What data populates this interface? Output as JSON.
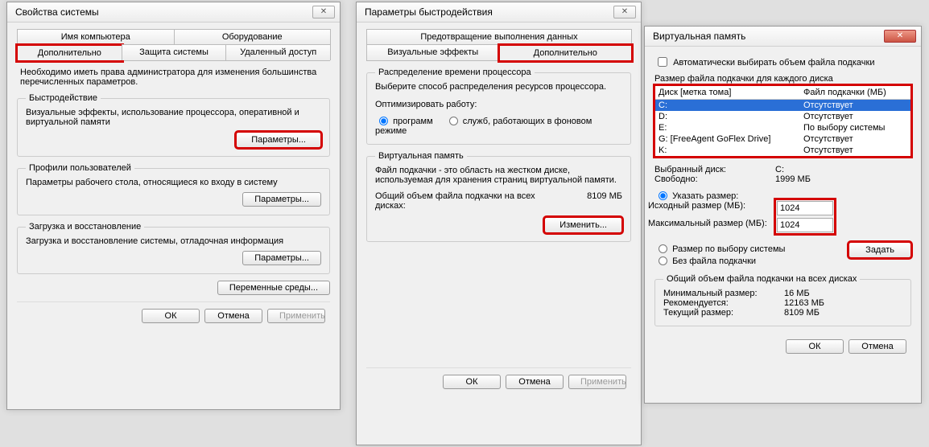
{
  "win1": {
    "title": "Свойства системы",
    "tabs_row1": [
      "Имя компьютера",
      "Оборудование"
    ],
    "tabs_row2": [
      "Дополнительно",
      "Защита системы",
      "Удаленный доступ"
    ],
    "note": "Необходимо иметь права администратора для изменения большинства перечисленных параметров.",
    "perf": {
      "legend": "Быстродействие",
      "text": "Визуальные эффекты, использование процессора, оперативной и виртуальной памяти",
      "btn": "Параметры..."
    },
    "profiles": {
      "legend": "Профили пользователей",
      "text": "Параметры рабочего стола, относящиеся ко входу в систему",
      "btn": "Параметры..."
    },
    "startup": {
      "legend": "Загрузка и восстановление",
      "text": "Загрузка и восстановление системы, отладочная информация",
      "btn": "Параметры..."
    },
    "envbtn": "Переменные среды...",
    "ok": "ОК",
    "cancel": "Отмена",
    "apply": "Применить"
  },
  "win2": {
    "title": "Параметры быстродействия",
    "tabs_row1": [
      "Предотвращение выполнения данных"
    ],
    "tabs_row2": [
      "Визуальные эффекты",
      "Дополнительно"
    ],
    "sched": {
      "legend": "Распределение времени процессора",
      "text": "Выберите способ распределения ресурсов процессора.",
      "opt_label": "Оптимизировать работу:",
      "opt1": "программ",
      "opt2": "служб, работающих в фоновом режиме"
    },
    "vm": {
      "legend": "Виртуальная память",
      "text": "Файл подкачки - это область на жестком диске, используемая для хранения страниц виртуальной памяти.",
      "total_label": "Общий объем файла подкачки на всех дисках:",
      "total_value": "8109 МБ",
      "btn": "Изменить..."
    },
    "ok": "ОК",
    "cancel": "Отмена",
    "apply": "Применить"
  },
  "win3": {
    "title": "Виртуальная память",
    "auto_chk": "Автоматически выбирать объем файла подкачки",
    "drives_label": "Размер файла подкачки для каждого диска",
    "col_drive": "Диск [метка тома]",
    "col_pf": "Файл подкачки (МБ)",
    "drives": [
      {
        "d": "C:",
        "l": "",
        "p": "Отсутствует",
        "sel": true
      },
      {
        "d": "D:",
        "l": "",
        "p": "Отсутствует"
      },
      {
        "d": "E:",
        "l": "",
        "p": "По выбору системы"
      },
      {
        "d": "G:",
        "l": "[FreeAgent GoFlex Drive]",
        "p": "Отсутствует"
      },
      {
        "d": "K:",
        "l": "",
        "p": "Отсутствует"
      }
    ],
    "selected_label": "Выбранный диск:",
    "selected_value": "C:",
    "free_label": "Свободно:",
    "free_value": "1999 МБ",
    "opt_custom": "Указать размер:",
    "init_label": "Исходный размер (МБ):",
    "init_value": "1024",
    "max_label": "Максимальный размер (МБ):",
    "max_value": "1024",
    "opt_system": "Размер по выбору системы",
    "opt_none": "Без файла подкачки",
    "set_btn": "Задать",
    "total_legend": "Общий объем файла подкачки на всех дисках",
    "min_label": "Минимальный размер:",
    "min_value": "16 МБ",
    "rec_label": "Рекомендуется:",
    "rec_value": "12163 МБ",
    "cur_label": "Текущий размер:",
    "cur_value": "8109 МБ",
    "ok": "ОК",
    "cancel": "Отмена"
  }
}
